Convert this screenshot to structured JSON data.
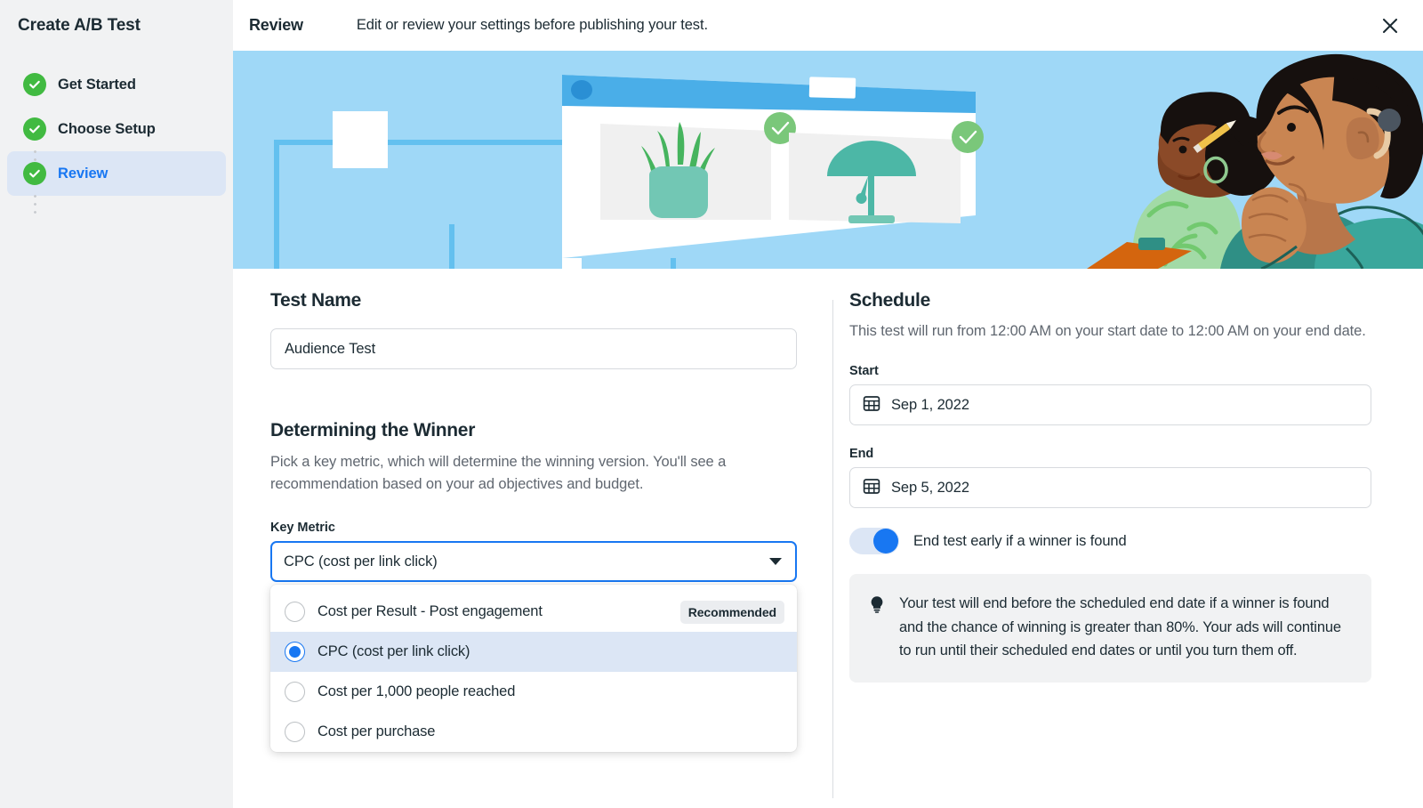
{
  "sidebar": {
    "title": "Create A/B Test",
    "steps": [
      {
        "label": "Get Started",
        "state": "complete"
      },
      {
        "label": "Choose Setup",
        "state": "complete"
      },
      {
        "label": "Review",
        "state": "active"
      }
    ]
  },
  "topbar": {
    "title": "Review",
    "subtitle": "Edit or review your settings before publishing your test.",
    "close_icon": "close-icon"
  },
  "hero": {
    "background_color": "#9fd8f7",
    "alt": "Two colleagues reviewing two ad creatives on a screen"
  },
  "test_name": {
    "heading": "Test Name",
    "value": "Audience Test",
    "placeholder": "Test Name"
  },
  "winner": {
    "heading": "Determining the Winner",
    "description": "Pick a key metric, which will determine the winning version. You'll see a recommendation based on your ad objectives and budget.",
    "key_metric_label": "Key Metric",
    "selected": "CPC (cost per link click)",
    "options": [
      {
        "label": "Cost per Result - Post engagement",
        "selected": false,
        "badge": "Recommended"
      },
      {
        "label": "CPC (cost per link click)",
        "selected": true,
        "badge": ""
      },
      {
        "label": "Cost per 1,000 people reached",
        "selected": false,
        "badge": ""
      },
      {
        "label": "Cost per purchase",
        "selected": false,
        "badge": ""
      }
    ]
  },
  "schedule": {
    "heading": "Schedule",
    "description": "This test will run from 12:00 AM on your start date to 12:00 AM on your end date.",
    "start_label": "Start",
    "start_value": "Sep 1, 2022",
    "end_label": "End",
    "end_value": "Sep 5, 2022",
    "toggle_label": "End test early if a winner is found",
    "toggle_on": true,
    "tip_text": "Your test will end before the scheduled end date if a winner is found and the chance of winning is greater than 80%. Your ads will continue to run until their scheduled end dates or until you turn them off."
  },
  "colors": {
    "accent_blue": "#1877f2",
    "step_green": "#41ba41",
    "sidebar_bg": "#f1f2f3",
    "selected_row": "#dce6f5",
    "text_primary": "#1c2b33",
    "text_secondary": "#606770"
  }
}
